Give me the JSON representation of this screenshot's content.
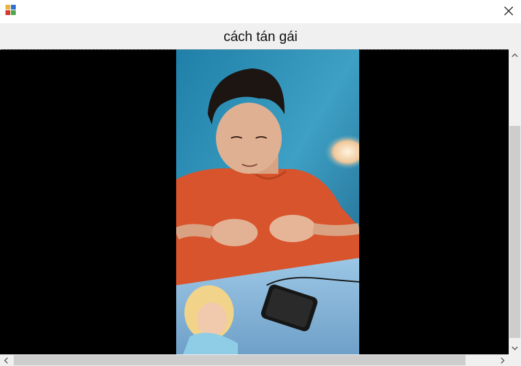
{
  "window": {
    "icon": "app-window-icon",
    "close_icon": "close-icon"
  },
  "video": {
    "title": "cách tán gái",
    "frame_description_icon": "video-frame-image"
  },
  "scrollbars": {
    "vertical": {
      "up_icon": "chevron-up-icon",
      "down_icon": "chevron-down-icon"
    },
    "horizontal": {
      "left_icon": "chevron-left-icon",
      "right_icon": "chevron-right-icon"
    }
  },
  "colors": {
    "viewport_bg": "#000000",
    "title_bar_bg": "#ffffff",
    "header_bg": "#f0f0f0",
    "scroll_track": "#f0f0f0",
    "scroll_thumb": "#cdcdcd"
  }
}
